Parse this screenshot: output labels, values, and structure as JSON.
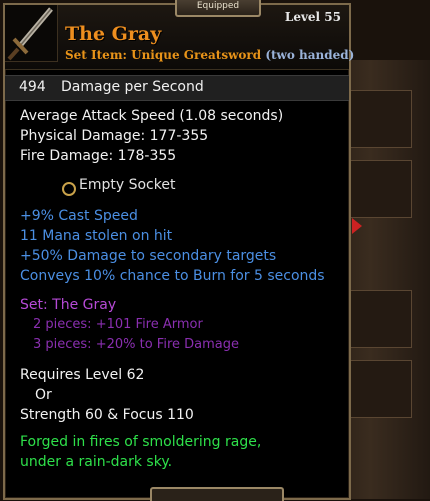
{
  "header": {
    "equipped_label": "Equipped",
    "item_name": "The Gray",
    "item_type": "Set Item: Unique Greatsword",
    "hands": "(two handed)",
    "level": "Level 55"
  },
  "dps": {
    "value": "494",
    "label": "Damage per Second"
  },
  "stats": {
    "attack_speed": "Average Attack Speed (1.08 seconds)",
    "physical": "Physical Damage: 177-355",
    "fire": "Fire Damage: 178-355"
  },
  "socket": {
    "label": "Empty Socket"
  },
  "magic": [
    "+9% Cast Speed",
    "11 Mana stolen on hit",
    "+50% Damage to secondary targets",
    "Conveys 10% chance to Burn for 5 seconds"
  ],
  "set": {
    "title": "Set: The Gray",
    "bonus_2": "2 pieces: +101 Fire Armor",
    "bonus_3": "3 pieces: +20% to Fire Damage"
  },
  "requirements": {
    "level": "Requires Level 62",
    "or": "Or",
    "attributes": "Strength 60 & Focus 110"
  },
  "flavor": {
    "line1": "Forged in fires of smoldering rage,",
    "line2": "under a rain-dark sky."
  },
  "colors": {
    "name": "#ef8f1f",
    "magic": "#4b8fe3",
    "set": "#b64ad6",
    "flavor": "#2ee04a"
  },
  "icons": [
    "greatsword-icon",
    "socket-icon"
  ]
}
